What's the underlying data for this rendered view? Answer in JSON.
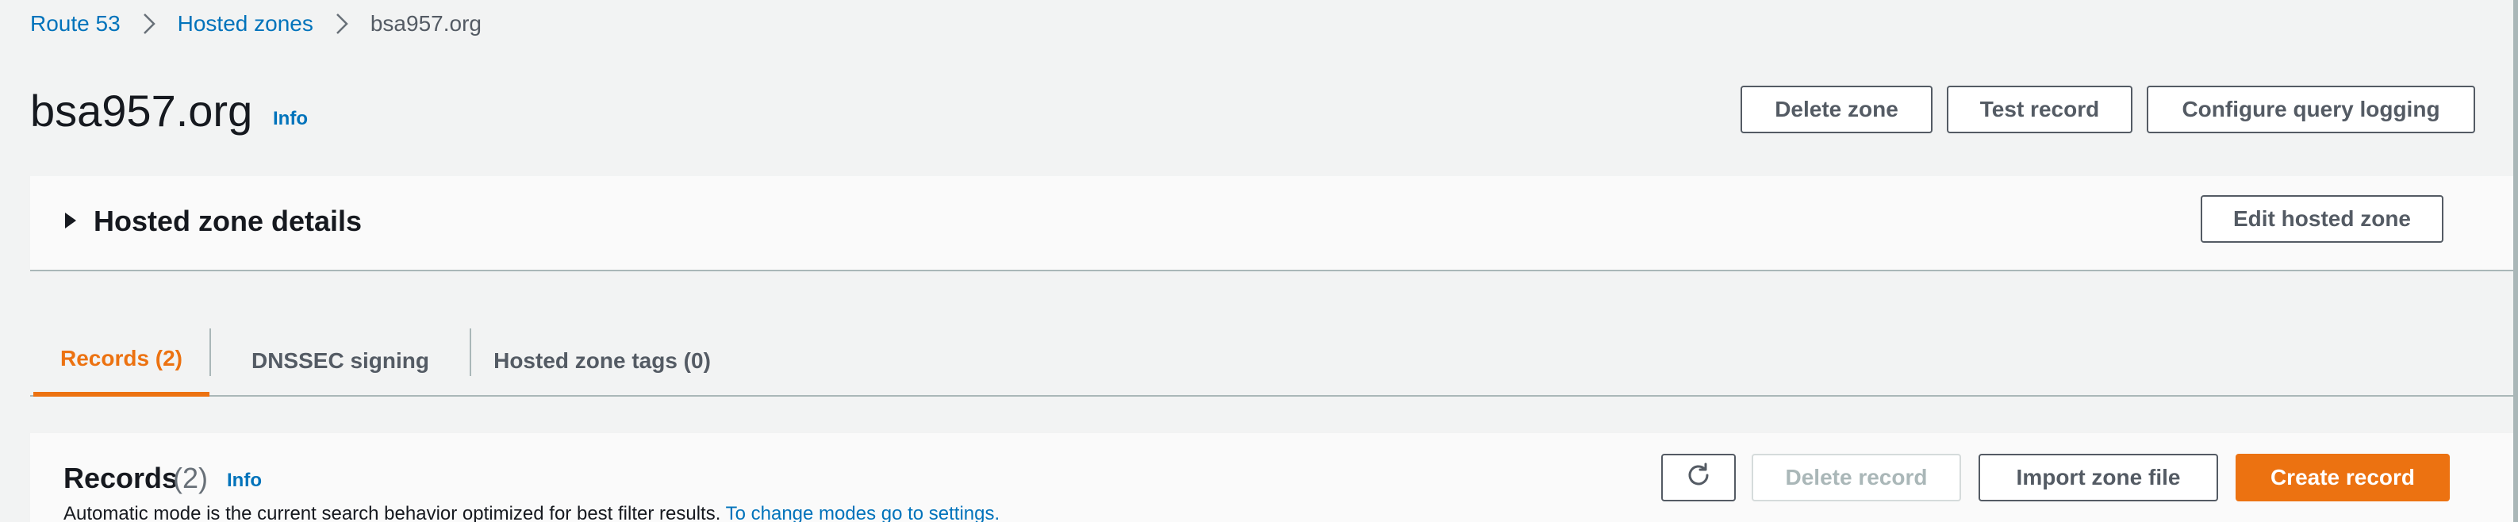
{
  "breadcrumb": {
    "items": [
      "Route 53",
      "Hosted zones"
    ],
    "current": "bsa957.org"
  },
  "header": {
    "title": "bsa957.org",
    "info": "Info",
    "buttons": {
      "delete_zone": "Delete zone",
      "test_record": "Test record",
      "configure_query_logging": "Configure query logging"
    }
  },
  "details": {
    "title": "Hosted zone details",
    "edit_button": "Edit hosted zone"
  },
  "tabs": [
    {
      "label": "Records (2)",
      "active": true
    },
    {
      "label": "DNSSEC signing",
      "active": false
    },
    {
      "label": "Hosted zone tags (0)",
      "active": false
    }
  ],
  "records": {
    "title": "Records",
    "count": "(2)",
    "info": "Info",
    "subtitle": "Automatic mode is the current search behavior optimized for best filter results.",
    "subtitle_link": "To change modes go to settings.",
    "buttons": {
      "refresh_icon": "refresh-icon",
      "delete_record": "Delete record",
      "import_zone_file": "Import zone file",
      "create_record": "Create record"
    }
  },
  "colors": {
    "accent": "#ec7211",
    "link": "#0073bb",
    "text": "#16191f",
    "muted": "#545b64",
    "background": "#f2f3f3"
  }
}
